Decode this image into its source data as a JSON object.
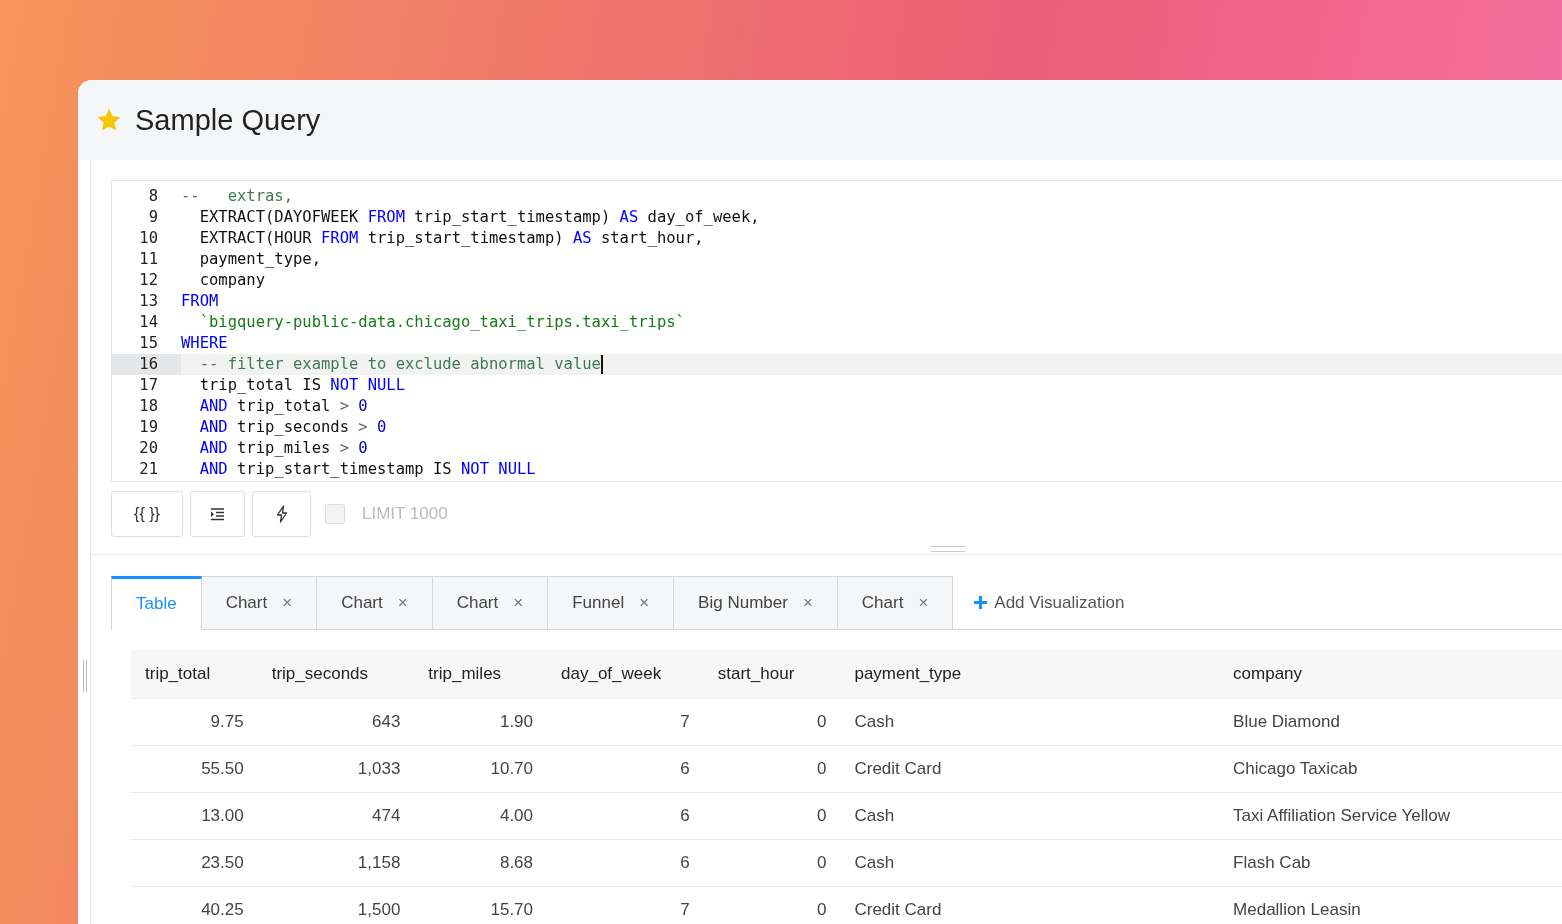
{
  "window": {
    "title": "Sample Query",
    "starred": true
  },
  "editor": {
    "lines": [
      {
        "number": "8",
        "active": false,
        "tokens": [
          {
            "kind": "comment",
            "text": "--   extras,"
          }
        ]
      },
      {
        "number": "9",
        "active": false,
        "tokens": [
          {
            "kind": "plain",
            "text": "  EXTRACT(DAYOFWEEK "
          },
          {
            "kind": "keyword",
            "text": "FROM"
          },
          {
            "kind": "plain",
            "text": " trip_start_timestamp) "
          },
          {
            "kind": "keyword",
            "text": "AS"
          },
          {
            "kind": "plain",
            "text": " day_of_week,"
          }
        ]
      },
      {
        "number": "10",
        "active": false,
        "tokens": [
          {
            "kind": "plain",
            "text": "  EXTRACT(HOUR "
          },
          {
            "kind": "keyword",
            "text": "FROM"
          },
          {
            "kind": "plain",
            "text": " trip_start_timestamp) "
          },
          {
            "kind": "keyword",
            "text": "AS"
          },
          {
            "kind": "plain",
            "text": " start_hour,"
          }
        ]
      },
      {
        "number": "11",
        "active": false,
        "tokens": [
          {
            "kind": "plain",
            "text": "  payment_type,"
          }
        ]
      },
      {
        "number": "12",
        "active": false,
        "tokens": [
          {
            "kind": "plain",
            "text": "  company"
          }
        ]
      },
      {
        "number": "13",
        "active": false,
        "tokens": [
          {
            "kind": "keyword",
            "text": "FROM"
          }
        ]
      },
      {
        "number": "14",
        "active": false,
        "tokens": [
          {
            "kind": "string",
            "text": "  `bigquery-public-data.chicago_taxi_trips.taxi_trips`"
          }
        ]
      },
      {
        "number": "15",
        "active": false,
        "tokens": [
          {
            "kind": "keyword",
            "text": "WHERE"
          }
        ]
      },
      {
        "number": "16",
        "active": true,
        "tokens": [
          {
            "kind": "comment",
            "text": "  -- filter example to exclude abnormal value"
          }
        ]
      },
      {
        "number": "17",
        "active": false,
        "tokens": [
          {
            "kind": "plain",
            "text": "  trip_total IS "
          },
          {
            "kind": "keyword",
            "text": "NOT NULL"
          }
        ]
      },
      {
        "number": "18",
        "active": false,
        "tokens": [
          {
            "kind": "keyword",
            "text": "  AND"
          },
          {
            "kind": "plain",
            "text": " trip_total "
          },
          {
            "kind": "operator",
            "text": "> "
          },
          {
            "kind": "number",
            "text": "0"
          }
        ]
      },
      {
        "number": "19",
        "active": false,
        "tokens": [
          {
            "kind": "keyword",
            "text": "  AND"
          },
          {
            "kind": "plain",
            "text": " trip_seconds "
          },
          {
            "kind": "operator",
            "text": "> "
          },
          {
            "kind": "number",
            "text": "0"
          }
        ]
      },
      {
        "number": "20",
        "active": false,
        "tokens": [
          {
            "kind": "keyword",
            "text": "  AND"
          },
          {
            "kind": "plain",
            "text": " trip_miles "
          },
          {
            "kind": "operator",
            "text": "> "
          },
          {
            "kind": "number",
            "text": "0"
          }
        ]
      },
      {
        "number": "21",
        "active": false,
        "tokens": [
          {
            "kind": "keyword",
            "text": "  AND"
          },
          {
            "kind": "plain",
            "text": " trip_start_timestamp IS "
          },
          {
            "kind": "keyword",
            "text": "NOT NULL"
          }
        ]
      }
    ]
  },
  "toolbar": {
    "buttons": [
      {
        "kind": "params",
        "text": "{{ }}"
      },
      {
        "kind": "indent"
      },
      {
        "kind": "bolt"
      }
    ],
    "limit": {
      "label": "LIMIT 1000",
      "checked": false,
      "disabled": true
    }
  },
  "tabs": [
    {
      "label": "Table",
      "selected": true
    },
    {
      "label": "Chart",
      "selected": false,
      "close": "×"
    },
    {
      "label": "Chart",
      "selected": false,
      "close": "×"
    },
    {
      "label": "Chart",
      "selected": false,
      "close": "×"
    },
    {
      "label": "Funnel",
      "selected": false,
      "close": "×"
    },
    {
      "label": "Big Number",
      "selected": false,
      "close": "×"
    },
    {
      "label": "Chart",
      "selected": false,
      "close": "×"
    }
  ],
  "add_visualization": "Add Visualization",
  "table": {
    "columns": [
      "trip_total",
      "trip_seconds",
      "trip_miles",
      "day_of_week",
      "start_hour",
      "payment_type",
      "company"
    ],
    "rows": [
      [
        "9.75",
        "643",
        "1.90",
        "7",
        "0",
        "Cash",
        "Blue Diamond"
      ],
      [
        "55.50",
        "1,033",
        "10.70",
        "6",
        "0",
        "Credit Card",
        "Chicago Taxicab"
      ],
      [
        "13.00",
        "474",
        "4.00",
        "6",
        "0",
        "Cash",
        "Taxi Affiliation Service Yellow"
      ],
      [
        "23.50",
        "1,158",
        "8.68",
        "6",
        "0",
        "Cash",
        "Flash Cab"
      ],
      [
        "40.25",
        "1,500",
        "15.70",
        "7",
        "0",
        "Credit Card",
        "Medallion Leasin"
      ]
    ]
  }
}
